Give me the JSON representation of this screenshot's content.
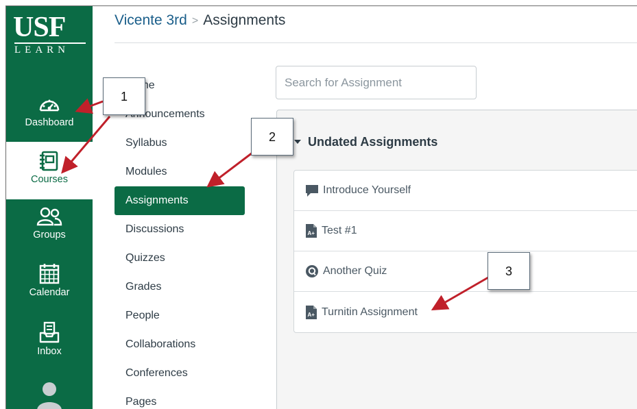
{
  "brand": {
    "logo_main": "USF",
    "logo_sub": "LEARN"
  },
  "global_nav": {
    "dashboard": "Dashboard",
    "courses": "Courses",
    "groups": "Groups",
    "calendar": "Calendar",
    "inbox": "Inbox"
  },
  "breadcrumb": {
    "course": "Vicente 3rd",
    "separator": ">",
    "current": "Assignments"
  },
  "course_nav": {
    "items": [
      {
        "label": "Home"
      },
      {
        "label": "Announcements"
      },
      {
        "label": "Syllabus"
      },
      {
        "label": "Modules"
      },
      {
        "label": "Assignments"
      },
      {
        "label": "Discussions"
      },
      {
        "label": "Quizzes"
      },
      {
        "label": "Grades"
      },
      {
        "label": "People"
      },
      {
        "label": "Collaborations"
      },
      {
        "label": "Conferences"
      },
      {
        "label": "Pages"
      }
    ]
  },
  "search": {
    "placeholder": "Search for Assignment"
  },
  "assignment_group": {
    "title": "Undated Assignments",
    "items": [
      {
        "label": "Introduce Yourself",
        "icon": "discussion-icon"
      },
      {
        "label": "Test #1",
        "icon": "assignment-icon"
      },
      {
        "label": "Another Quiz",
        "icon": "quiz-icon"
      },
      {
        "label": "Turnitin Assignment",
        "icon": "assignment-icon"
      }
    ]
  },
  "callouts": {
    "one": "1",
    "two": "2",
    "three": "3"
  },
  "colors": {
    "brand_green": "#0b6b45",
    "arrow_red": "#c0202a",
    "link_blue": "#1a5e8a"
  }
}
